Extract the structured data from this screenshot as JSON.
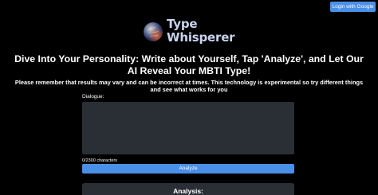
{
  "header": {
    "login_label": "Login with Google"
  },
  "brand": {
    "name_line1": "Type",
    "name_line2": "Whisperer",
    "logo_icon": "brain-sphere-icon"
  },
  "headline": {
    "line1": "Dive Into Your Personality: Write about Yourself, Tap 'Analyze', and Let Our",
    "line2": "AI Reveal Your MBTI Type!"
  },
  "disclaimer": {
    "line1": "Please remember that results may vary and can be incorrect at times. This technology is experimental so try different things",
    "line2": "and see what works for you"
  },
  "form": {
    "dialogue_label": "Dialogue:",
    "dialogue_value": "",
    "char_count": "0/2300 characters",
    "analyze_label": "Analyze"
  },
  "analysis": {
    "title": "Analysis:"
  },
  "colors": {
    "background": "#000000",
    "accent": "#4a8fe8",
    "panel": "#2a2f36",
    "brand_text": "#c9d3ee"
  }
}
